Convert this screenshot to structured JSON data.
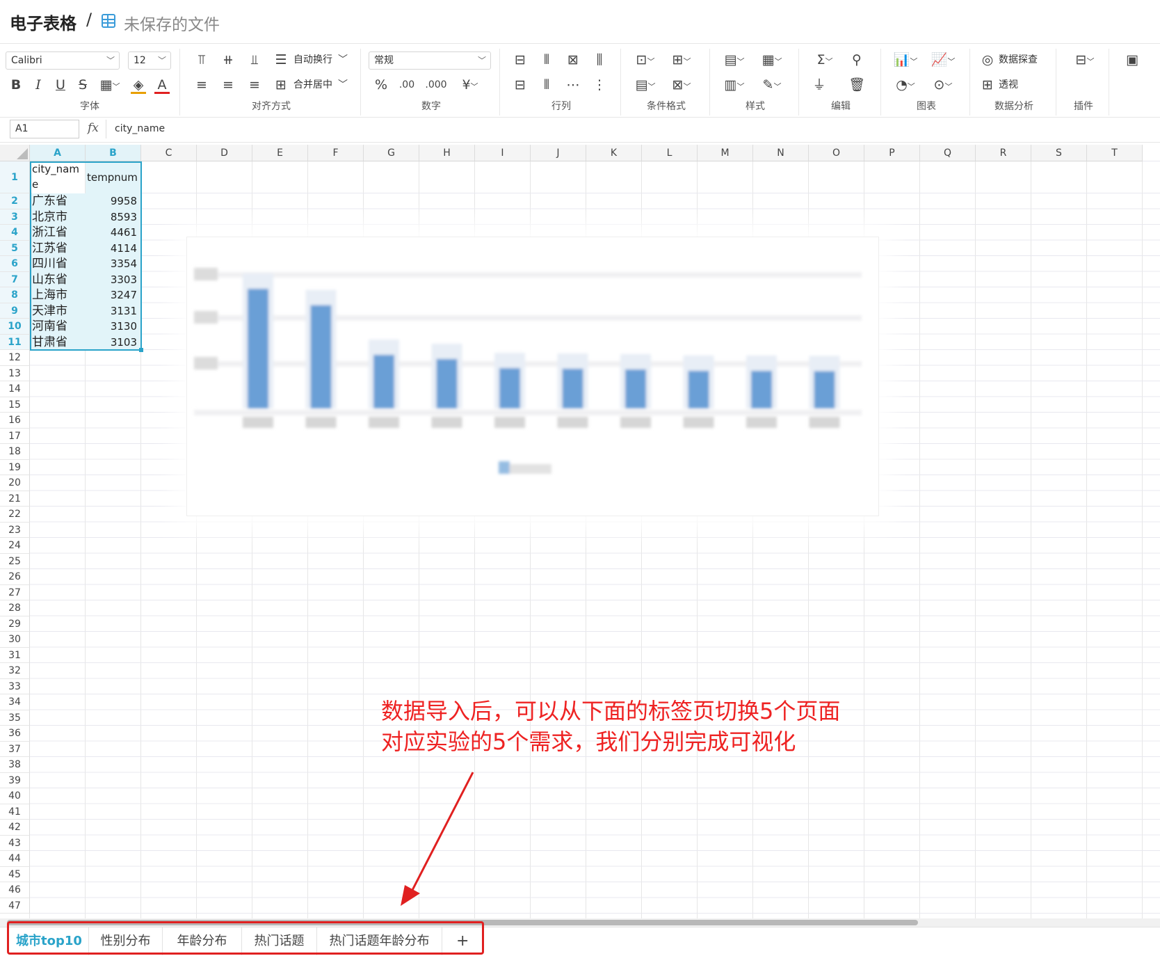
{
  "header": {
    "app_title": "电子表格",
    "separator": "/",
    "file_name": "未保存的文件"
  },
  "ribbon": {
    "font_name": "Calibri",
    "font_size": "12",
    "wrap_text": "自动换行",
    "merge_center": "合并居中",
    "number_format": "常规",
    "data_explore": "数据探查",
    "pivot": "透视",
    "groups": [
      "字体",
      "对齐方式",
      "数字",
      "行列",
      "条件格式",
      "样式",
      "编辑",
      "图表",
      "数据分析",
      "插件"
    ]
  },
  "formula_bar": {
    "cell_ref": "A1",
    "fx": "fx",
    "formula": "city_name"
  },
  "columns": [
    "A",
    "B",
    "C",
    "D",
    "E",
    "F",
    "G",
    "H",
    "I",
    "J",
    "K",
    "L",
    "M",
    "N",
    "O",
    "P",
    "Q",
    "R",
    "S",
    "T"
  ],
  "rows_count": 47,
  "table": {
    "header_a_line1": "city_nam",
    "header_a_line2": "e",
    "header_b": "tempnum",
    "rows": [
      {
        "city": "广东省",
        "value": "9958"
      },
      {
        "city": "北京市",
        "value": "8593"
      },
      {
        "city": "浙江省",
        "value": "4461"
      },
      {
        "city": "江苏省",
        "value": "4114"
      },
      {
        "city": "四川省",
        "value": "3354"
      },
      {
        "city": "山东省",
        "value": "3303"
      },
      {
        "city": "上海市",
        "value": "3247"
      },
      {
        "city": "天津市",
        "value": "3131"
      },
      {
        "city": "河南省",
        "value": "3130"
      },
      {
        "city": "甘肃省",
        "value": "3103"
      }
    ]
  },
  "chart": {
    "bar_color": "#6a9fd6",
    "values": [
      9958,
      8593,
      4461,
      4114,
      3354,
      3303,
      3247,
      3131,
      3130,
      3103
    ]
  },
  "annotation": {
    "line1": "数据导入后，可以从下面的标签页切换5个页面",
    "line2": "对应实验的5个需求，我们分别完成可视化",
    "color": "#ee2222"
  },
  "sheet_tabs": [
    "城市top10",
    "性别分布",
    "年龄分布",
    "热门话题",
    "热门话题年龄分布"
  ],
  "add_sheet": "+"
}
